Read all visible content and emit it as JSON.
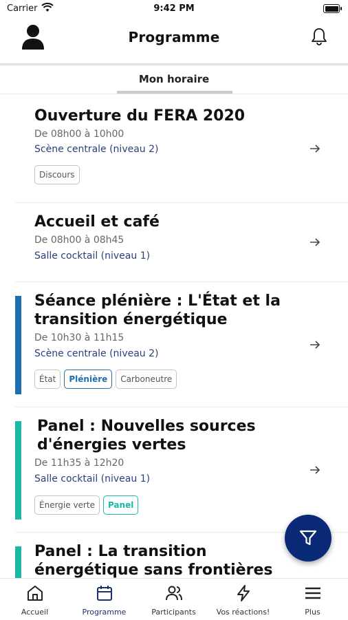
{
  "status_bar": {
    "carrier": "Carrier",
    "time": "9:42 PM"
  },
  "header": {
    "title": "Programme"
  },
  "tabs": {
    "active": "Mon horaire"
  },
  "sessions": [
    {
      "title": "Ouverture du FERA 2020",
      "time": "De 08h00 à 10h00",
      "location": "Scène centrale (niveau 2)",
      "tags": [
        {
          "label": "Discours"
        }
      ]
    },
    {
      "title": "Accueil et café",
      "time": "De 08h00 à 08h45",
      "location": "Salle cocktail (niveau 1)",
      "tags": []
    },
    {
      "title": "Séance plénière : L'État et la transition énergétique",
      "time": "De 10h30 à 11h15",
      "location": "Scène centrale (niveau 2)",
      "accent_color": "#1f6fae",
      "tags": [
        {
          "label": "État"
        },
        {
          "label": "Plénière",
          "color": "#1f6fae"
        },
        {
          "label": "Carboneutre"
        }
      ]
    },
    {
      "title": "Panel : Nouvelles sources d'énergies vertes",
      "time": "De 11h35 à 12h20",
      "location": "Salle cocktail (niveau 1)",
      "accent_color": "#1bb8a3",
      "tags": [
        {
          "label": "Énergie verte"
        },
        {
          "label": "Panel",
          "color": "#1bb8a3"
        }
      ]
    },
    {
      "title": "Panel : La transition énergétique sans frontières",
      "accent_color": "#1bb8a3"
    }
  ],
  "fab": {
    "icon": "filter-icon",
    "color": "#0a2a77"
  },
  "tab_bar": [
    {
      "label": "Accueil",
      "icon": "home-icon"
    },
    {
      "label": "Programme",
      "icon": "calendar-icon",
      "active": true
    },
    {
      "label": "Participants",
      "icon": "people-icon"
    },
    {
      "label": "Vos réactions!",
      "icon": "lightning-icon"
    },
    {
      "label": "Plus",
      "icon": "menu-icon"
    }
  ],
  "colors": {
    "primary": "#0a2a77",
    "location_text": "#2b3f7a"
  }
}
